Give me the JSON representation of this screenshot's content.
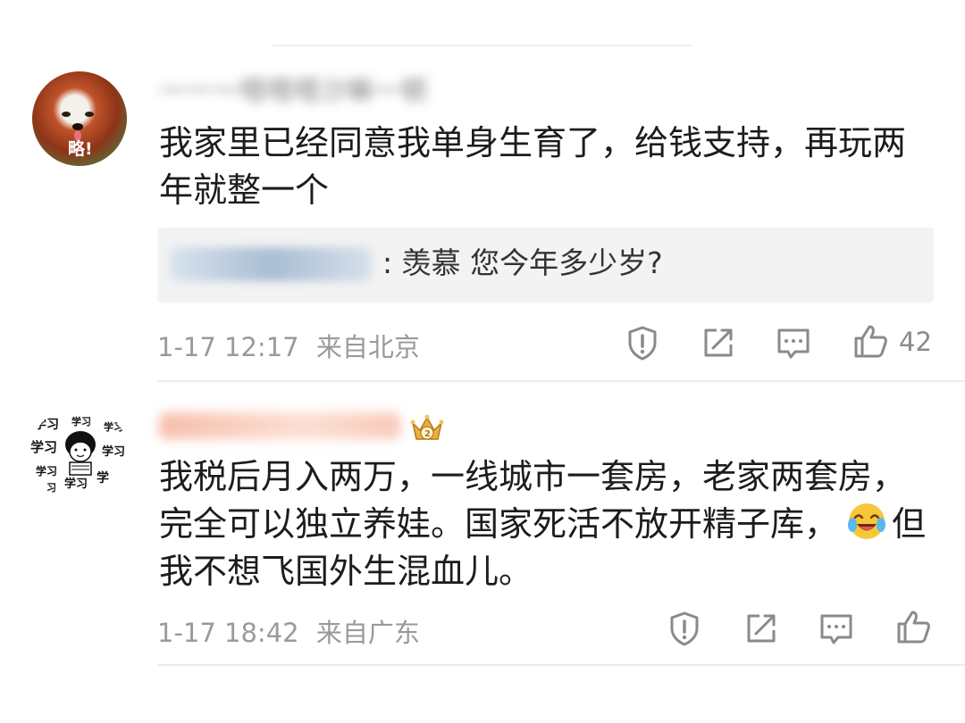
{
  "comments": [
    {
      "username": "一一一嗒嗒嗒沙嘛一顿",
      "text": "我家里已经同意我单身生育了，给钱支持，再玩两年就整一个",
      "avatar_label": "略!",
      "reply": {
        "user": "",
        "text": ": 羡慕 您今年多少岁?"
      },
      "date": "1-17 12:17",
      "location": "来自北京",
      "likes": "42"
    },
    {
      "username": "",
      "text_part1": "我税后月入两万，一线城市一套房，老家两套房，完全可以独立养娃。国家死活不放开精子库，",
      "text_part2": "但我不想飞国外生混血儿。",
      "avatar_label": "学习",
      "date": "1-17 18:42",
      "location": "来自广东",
      "likes": ""
    }
  ],
  "icons": [
    "report-icon",
    "share-icon",
    "comment-icon",
    "like-icon",
    "laughing-crying-emoji",
    "crown-badge-icon"
  ],
  "colors": {
    "text": "#1c1c1c",
    "meta": "#9a9a9a",
    "reply_bg": "#f3f3f3"
  }
}
